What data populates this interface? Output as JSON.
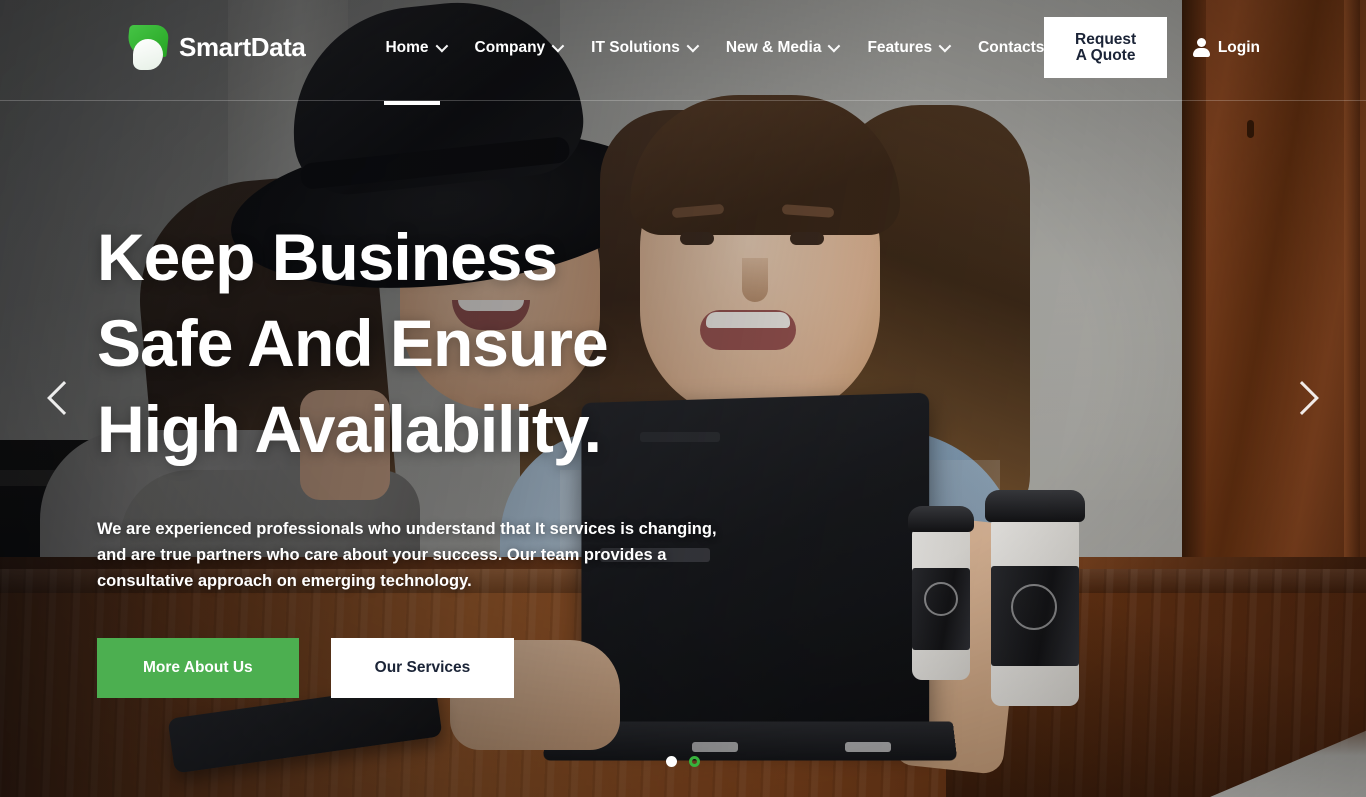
{
  "brand": {
    "name": "SmartData",
    "logo_icon": "leaf-drop-logo"
  },
  "nav": {
    "items": [
      {
        "label": "Home",
        "has_dropdown": true,
        "active": true
      },
      {
        "label": "Company",
        "has_dropdown": true,
        "active": false
      },
      {
        "label": "IT Solutions",
        "has_dropdown": true,
        "active": false
      },
      {
        "label": "New & Media",
        "has_dropdown": true,
        "active": false
      },
      {
        "label": "Features",
        "has_dropdown": true,
        "active": false
      },
      {
        "label": "Contacts",
        "has_dropdown": false,
        "active": false
      }
    ]
  },
  "actions": {
    "quote_label": "Request A Quote",
    "login_label": "Login",
    "login_icon": "user-icon"
  },
  "hero": {
    "headline_line1": "Keep Business",
    "headline_line2": "Safe And Ensure",
    "headline_line3": "High Availability.",
    "subtext": "We are experienced professionals who understand that It services is changing, and are true partners who care about your success. Our team provides a consultative approach on emerging technology.",
    "primary_button": "More About Us",
    "secondary_button": "Our Services",
    "prev_icon": "chevron-left-icon",
    "next_icon": "chevron-right-icon",
    "slides": [
      {
        "index": 1,
        "active": false
      },
      {
        "index": 2,
        "active": true
      }
    ]
  },
  "colors": {
    "brand_green": "#4caf50",
    "dot_active_green": "#37b23c",
    "button_text_dark": "#1b2437",
    "white": "#ffffff"
  }
}
